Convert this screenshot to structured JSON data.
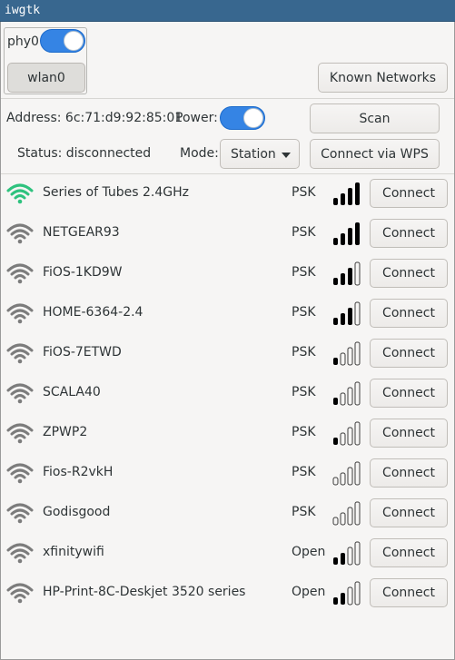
{
  "window": {
    "title": "iwgtk"
  },
  "device": {
    "phy_label": "phy0",
    "phy_switch_on": true,
    "interface_button": "wlan0"
  },
  "known_networks_button": "Known Networks",
  "adapter": {
    "address_label": "Address: 6c:71:d9:92:85:01",
    "power_label": "Power:",
    "power_on": true,
    "status_label": "Status: disconnected",
    "mode_label": "Mode:",
    "mode_value": "Station",
    "scan_button": "Scan",
    "wps_button": "Connect via WPS"
  },
  "colors": {
    "accent": "#3584e4",
    "connected_wifi": "#2ec27e",
    "titlebar": "#38678f"
  },
  "networks": [
    {
      "ssid": "Series of Tubes 2.4GHz",
      "security": "PSK",
      "signal_level": 4,
      "icon": "wifi-active-icon",
      "button": "Connect"
    },
    {
      "ssid": "NETGEAR93",
      "security": "PSK",
      "signal_level": 4,
      "icon": "wifi-icon",
      "button": "Connect"
    },
    {
      "ssid": "FiOS-1KD9W",
      "security": "PSK",
      "signal_level": 3,
      "icon": "wifi-icon",
      "button": "Connect"
    },
    {
      "ssid": "HOME-6364-2.4",
      "security": "PSK",
      "signal_level": 3,
      "icon": "wifi-icon",
      "button": "Connect"
    },
    {
      "ssid": "FiOS-7ETWD",
      "security": "PSK",
      "signal_level": 1,
      "icon": "wifi-icon",
      "button": "Connect"
    },
    {
      "ssid": "SCALA40",
      "security": "PSK",
      "signal_level": 1,
      "icon": "wifi-icon",
      "button": "Connect"
    },
    {
      "ssid": "ZPWP2",
      "security": "PSK",
      "signal_level": 1,
      "icon": "wifi-icon",
      "button": "Connect"
    },
    {
      "ssid": "Fios-R2vkH",
      "security": "PSK",
      "signal_level": 0,
      "icon": "wifi-icon",
      "button": "Connect"
    },
    {
      "ssid": "Godisgood",
      "security": "PSK",
      "signal_level": 0,
      "icon": "wifi-icon",
      "button": "Connect"
    },
    {
      "ssid": "xfinitywifi",
      "security": "Open",
      "signal_level": 2,
      "icon": "wifi-icon",
      "button": "Connect"
    },
    {
      "ssid": "HP-Print-8C-Deskjet 3520 series",
      "security": "Open",
      "signal_level": 2,
      "icon": "wifi-icon",
      "button": "Connect"
    }
  ]
}
